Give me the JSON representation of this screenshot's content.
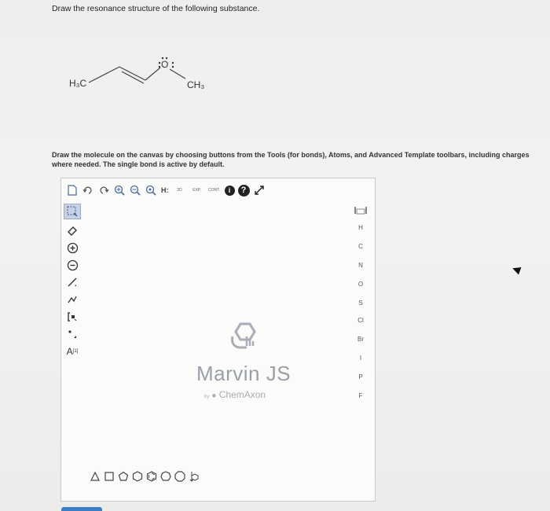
{
  "question": {
    "text": "Draw the resonance structure of the following substance."
  },
  "molecule": {
    "left_label": "H₃C",
    "right_label": "CH₃",
    "oxygen_label": "O"
  },
  "instructions": {
    "text": "Draw the molecule on the canvas by choosing buttons from the Tools (for bonds), Atoms, and Advanced Template toolbars, including charges where needed. The single bond is active by default."
  },
  "editor": {
    "top_toolbar": {
      "hydrogen_label": "H:",
      "twod_label": "2D",
      "exp_label": "EXP.",
      "cont_label": "CONT.",
      "info_label": "i",
      "help_label": "?"
    },
    "left_toolbar": {
      "charge_plus": "+",
      "charge_minus": "−",
      "attachment_label": "[1]",
      "a_label": "A"
    },
    "atoms": [
      "H",
      "C",
      "N",
      "O",
      "S",
      "Cl",
      "Br",
      "I",
      "P",
      "F"
    ],
    "periodic_icon_label": "periodic-table",
    "watermark": {
      "title": "Marvin JS",
      "by": "by",
      "brand": "ChemAxon"
    }
  }
}
